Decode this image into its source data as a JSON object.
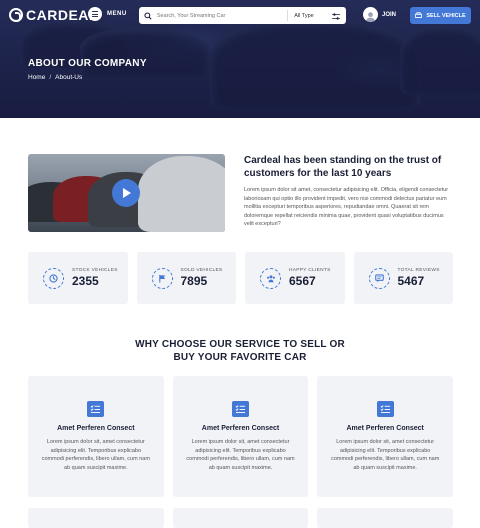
{
  "header": {
    "logo": "CARDEAL",
    "menu_label": "MENU",
    "search_placeholder": "Search, Your Streaming Car",
    "type_select": "All Type",
    "join_label": "JOIN",
    "sell_label": "SELL VEHICLE"
  },
  "hero": {
    "title": "ABOUT OUR COMPANY",
    "breadcrumb": [
      "Home",
      "/",
      "About-Us"
    ]
  },
  "about": {
    "heading": "Cardeal has been standing on the trust of customers for the last 10 years",
    "body": "Lorem ipsum dolor sit amet, consectetur adipisicing elit. Officia, eligendi consectetur laboriosam qui optio illo provident impedit, vero nisi commodi delectus pariatur eum mollitia excepturi temporibus asperiores, repudiandae omni. Quaerat sit rem doloremque repellat reiciendis minima quae, provident quasi voluptatibus ducimus velit excepturi?"
  },
  "stats": [
    {
      "label": "STOCK VEHICLES",
      "value": "2355",
      "icon": "clock-icon"
    },
    {
      "label": "SOLD VEHICLES",
      "value": "7895",
      "icon": "flag-icon"
    },
    {
      "label": "HAPPY CLIENTS",
      "value": "6567",
      "icon": "users-icon"
    },
    {
      "label": "TOTAL REVIEWS",
      "value": "5467",
      "icon": "chat-icon"
    }
  ],
  "why": {
    "line1": "WHY CHOOSE OUR SERVICE TO SELL OR",
    "line2": "BUY YOUR FAVORITE CAR"
  },
  "cards": [
    {
      "title": "Amet Perferen Consect",
      "text": "Lorem ipsum dolor sit, amet consectetur adipisicing elit. Temporibus explicabo commodi perferendis, libero ullam, cum nam ab quam suscipit maxime."
    },
    {
      "title": "Amet Perferen Consect",
      "text": "Lorem ipsum dolor sit, amet consectetur adipisicing elit. Temporibus explicabo commodi perferendis, libero ullam, cum nam ab quam suscipit maxime."
    },
    {
      "title": "Amet Perferen Consect",
      "text": "Lorem ipsum dolor sit, amet consectetur adipisicing elit. Temporibus explicabo commodi perferendis, libero ullam, cum nam ab quam suscipit maxime."
    }
  ],
  "colors": {
    "accent": "#4378d6",
    "dark": "#1a1f36",
    "card_bg": "#f2f3f7"
  }
}
